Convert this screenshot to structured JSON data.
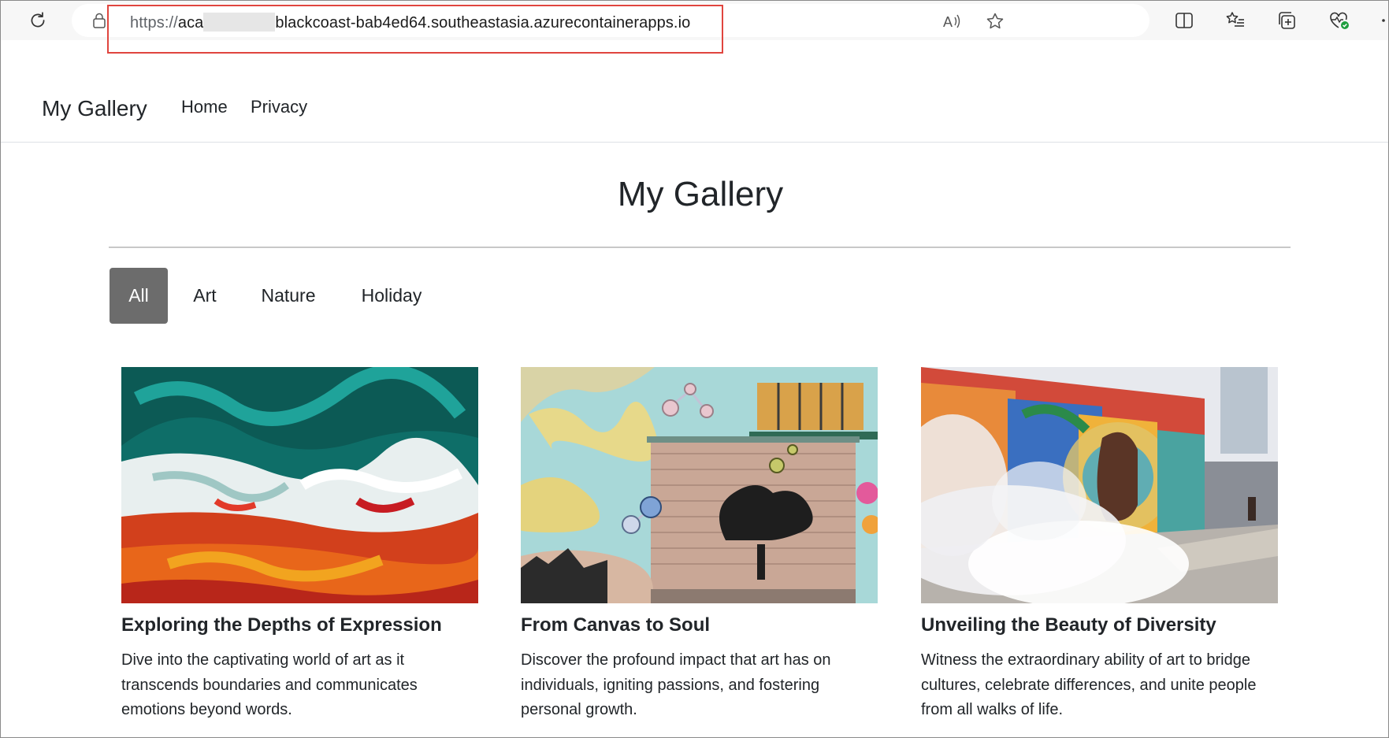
{
  "browser": {
    "url_scheme": "https://",
    "url_prefix": "aca",
    "url_host": "blackcoast-bab4ed64.southeastasia.azurecontainerapps.io",
    "icons": [
      "reload-icon",
      "lock-icon",
      "read-aloud-icon",
      "favorite-star-icon",
      "split-screen-icon",
      "favorites-list-icon",
      "collections-icon",
      "browser-essentials-icon",
      "more-icon"
    ],
    "highlight_color": "#e0453e"
  },
  "navbar": {
    "brand": "My Gallery",
    "links": [
      "Home",
      "Privacy"
    ]
  },
  "page": {
    "title": "My Gallery",
    "filters": [
      "All",
      "Art",
      "Nature",
      "Holiday"
    ],
    "active_filter": "All",
    "active_filter_color": "#6c6c6c"
  },
  "cards": [
    {
      "title": "Exploring the Depths of Expression",
      "text": "Dive into the captivating world of art as it transcends boundaries and communicates emotions beyond words.",
      "image": "abstract-painting-image"
    },
    {
      "title": "From Canvas to Soul",
      "text": "Discover the profound impact that art has on individuals, igniting passions, and fostering personal growth.",
      "image": "mural-wall-image"
    },
    {
      "title": "Unveiling the Beauty of Diversity",
      "text": "Witness the extraordinary ability of art to bridge cultures, celebrate differences, and unite people from all walks of life.",
      "image": "street-mural-steam-image"
    }
  ]
}
